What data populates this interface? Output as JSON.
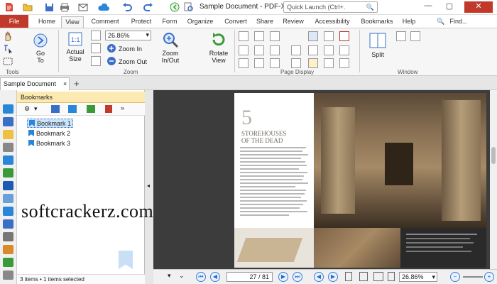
{
  "app": {
    "title": "Sample Document - PDF-XCha",
    "quick_launch_placeholder": "Quick Launch (Ctrl+."
  },
  "header": {
    "find_label": "Find...",
    "window_minimize": "—",
    "window_maximize": "▢",
    "window_close": "✕"
  },
  "tabs": [
    "File",
    "Home",
    "View",
    "Comment",
    "Protect",
    "Form",
    "Organize",
    "Convert",
    "Share",
    "Review",
    "Accessibility",
    "Bookmarks",
    "Help"
  ],
  "active_tab": "View",
  "ribbon": {
    "go_to": "Go\nTo",
    "actual_size": "Actual\nSize",
    "zoom_value": "26.86%",
    "zoom_in": "Zoom In",
    "zoom_out": "Zoom Out",
    "zoom_in_out": "Zoom\nIn/Out",
    "rotate_view": "Rotate\nView",
    "split": "Split",
    "groups": {
      "tools": "Tools",
      "zoom": "Zoom",
      "page_display": "Page Display",
      "window": "Window"
    }
  },
  "document_tab": {
    "label": "Sample Document",
    "close": "×",
    "new": "+"
  },
  "bookmarks": {
    "title": "Bookmarks",
    "items": [
      "Bookmark 1",
      "Bookmark 2",
      "Bookmark 3"
    ],
    "selected": "Bookmark 1",
    "status": "3 items • 1 items selected"
  },
  "page": {
    "chapter_number": "5",
    "chapter_title": "STOREHOUSES\nOF THE DEAD"
  },
  "watermark": "softcrackerz.com",
  "statusbar": {
    "page_current": "27",
    "page_total": "81",
    "zoom": "26.86%"
  },
  "colors": {
    "file_tab": "#c0392b",
    "accent": "#2a6ac9",
    "bookmark_header": "#fdeab2"
  }
}
